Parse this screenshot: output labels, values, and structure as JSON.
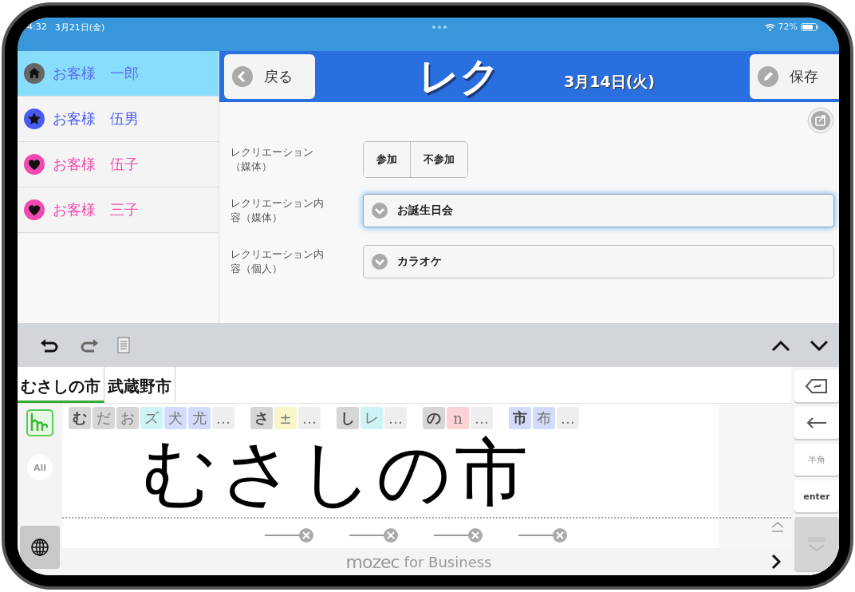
{
  "status_bar": {
    "time": "4:32",
    "date": "3月21日(金)",
    "battery": "72%"
  },
  "sidebar": {
    "items": [
      {
        "kind": "home",
        "name": "お客様　一郎",
        "color": "#5a6cf0",
        "selected": true
      },
      {
        "kind": "star",
        "name": "お客様　伍男",
        "color": "#4a5cf0",
        "selected": false
      },
      {
        "kind": "heart",
        "name": "お客様　伍子",
        "color": "#f04ab0",
        "selected": false
      },
      {
        "kind": "heart",
        "name": "お客様　三子",
        "color": "#f04ab0",
        "selected": false
      }
    ]
  },
  "header": {
    "back": "戻る",
    "title": "レク",
    "date": "3月14日(火)",
    "save": "保存"
  },
  "form": [
    {
      "kind": "toggle",
      "label": [
        "レクリエーション",
        "（媒体）"
      ],
      "options": [
        {
          "label": "参加",
          "selected": false
        },
        {
          "label": "不参加",
          "selected": false
        }
      ]
    },
    {
      "kind": "select",
      "label": [
        "レクリエーション内",
        "容（媒体）"
      ],
      "value": "お誕生日会",
      "focused": true
    },
    {
      "kind": "select",
      "label": [
        "レクリエーション内",
        "容（個人）"
      ],
      "value": "カラオケ",
      "focused": false
    }
  ],
  "keyboard": {
    "tabs": [
      {
        "label": "むさしの市",
        "selected": true
      },
      {
        "label": "武蔵野市",
        "selected": false
      }
    ],
    "candidate_groups": [
      [
        {
          "text": "む",
          "color": "#d6d6d6",
          "selected": true
        },
        {
          "text": "だ",
          "color": "#d6d6d6",
          "selected": false
        },
        {
          "text": "お",
          "color": "#d6d6d6",
          "selected": false
        },
        {
          "text": "ズ",
          "color": "#cdf3f5",
          "selected": false
        },
        {
          "text": "犬",
          "color": "#d3dbfb",
          "selected": false
        },
        {
          "text": "尤",
          "color": "#d3dbfb",
          "selected": false
        },
        {
          "text": "…",
          "color": "#eeeeee",
          "selected": false
        }
      ],
      [
        {
          "text": "さ",
          "color": "#d6d6d6",
          "selected": true
        },
        {
          "text": "±",
          "color": "#f8f6c8",
          "selected": false
        },
        {
          "text": "…",
          "color": "#eeeeee",
          "selected": false
        }
      ],
      [
        {
          "text": "し",
          "color": "#d6d6d6",
          "selected": true
        },
        {
          "text": "レ",
          "color": "#cdf3f5",
          "selected": false
        },
        {
          "text": "…",
          "color": "#eeeeee",
          "selected": false
        }
      ],
      [
        {
          "text": "の",
          "color": "#d6d6d6",
          "selected": true
        },
        {
          "text": "n",
          "color": "#fbd3d6",
          "selected": false
        },
        {
          "text": "…",
          "color": "#eeeeee",
          "selected": false
        }
      ],
      [
        {
          "text": "市",
          "color": "#d3dbfb",
          "selected": true
        },
        {
          "text": "布",
          "color": "#d3dbfb",
          "selected": false
        },
        {
          "text": "…",
          "color": "#eeeeee",
          "selected": false
        }
      ]
    ],
    "handwriting": "むさしの市",
    "side_key": "All",
    "space_key": "半角",
    "enter_key": "enter",
    "brand": "mozec",
    "brand_suffix": "for Business"
  }
}
